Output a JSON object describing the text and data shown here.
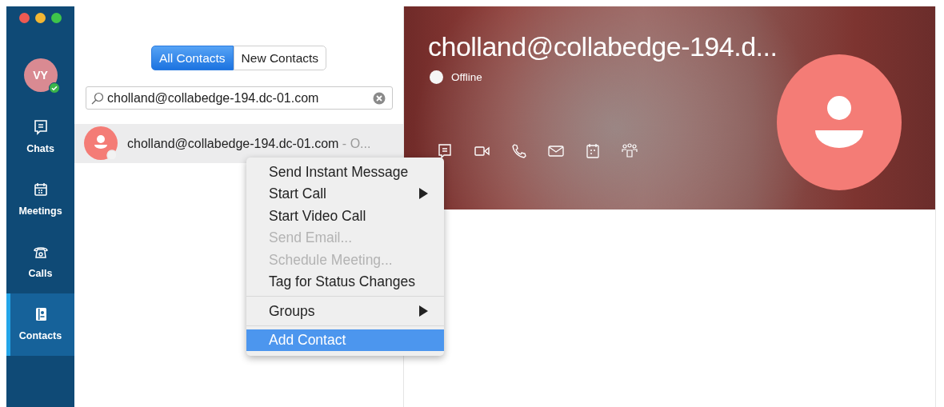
{
  "user": {
    "initials": "VY",
    "online": true
  },
  "nav": [
    {
      "label": "Chats",
      "kind": "chats",
      "selected": false
    },
    {
      "label": "Meetings",
      "kind": "meetings",
      "selected": false
    },
    {
      "label": "Calls",
      "kind": "calls",
      "selected": false
    },
    {
      "label": "Contacts",
      "kind": "contacts",
      "selected": true
    }
  ],
  "tabs": [
    {
      "label": "All Contacts",
      "selected": true
    },
    {
      "label": "New Contacts",
      "selected": false
    }
  ],
  "search": {
    "value": "cholland@collabedge-194.dc-01.com"
  },
  "results": [
    {
      "name": "cholland@collabedge-194.dc-01.com",
      "status": "- O...",
      "selected": true
    }
  ],
  "profile": {
    "name": "cholland@collabedge-194.d...",
    "status": "Offline",
    "actions": [
      {
        "kind": "chat"
      },
      {
        "kind": "video"
      },
      {
        "kind": "phone"
      },
      {
        "kind": "email"
      },
      {
        "kind": "calendar"
      },
      {
        "kind": "people"
      }
    ]
  },
  "context_menu": [
    {
      "kind": "item",
      "label": "Send Instant Message",
      "disabled": false,
      "submenu": false,
      "selected": false
    },
    {
      "kind": "item",
      "label": "Start Call",
      "disabled": false,
      "submenu": true,
      "selected": false
    },
    {
      "kind": "item",
      "label": "Start Video Call",
      "disabled": false,
      "submenu": false,
      "selected": false
    },
    {
      "kind": "item",
      "label": "Send Email...",
      "disabled": true,
      "submenu": false,
      "selected": false
    },
    {
      "kind": "item",
      "label": "Schedule Meeting...",
      "disabled": true,
      "submenu": false,
      "selected": false
    },
    {
      "kind": "item",
      "label": "Tag for Status Changes",
      "disabled": false,
      "submenu": false,
      "selected": false
    },
    {
      "kind": "separator"
    },
    {
      "kind": "item",
      "label": "Groups",
      "disabled": false,
      "submenu": true,
      "selected": false
    },
    {
      "kind": "separator"
    },
    {
      "kind": "item",
      "label": "Add Contact",
      "disabled": false,
      "submenu": false,
      "selected": true
    }
  ]
}
